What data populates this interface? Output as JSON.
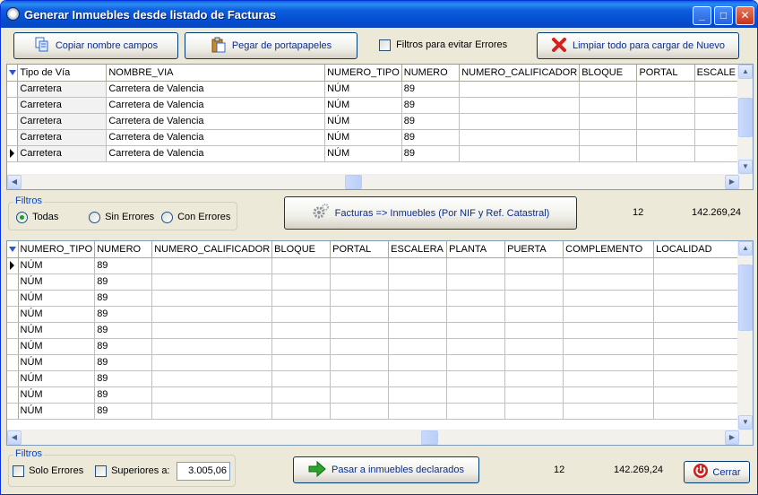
{
  "window": {
    "title": "Generar Inmuebles desde listado de Facturas",
    "controls": {
      "minimize": "_",
      "maximize": "□",
      "close": "✕"
    }
  },
  "toolbar": {
    "copy_fields": "Copiar nombre campos",
    "paste_clipboard": "Pegar de portapapeles",
    "filters_checkbox": "Filtros para evitar Errores",
    "clear_all": "Limpiar todo para cargar de Nuevo"
  },
  "top_grid": {
    "columns": [
      "Tipo de Vía",
      "NOMBRE_VIA",
      "NUMERO_TIPO",
      "NUMERO",
      "NUMERO_CALIFICADOR",
      "BLOQUE",
      "PORTAL",
      "ESCALE"
    ],
    "rows": [
      [
        "Carretera",
        "Carretera de Valencia",
        "NÚM",
        "89",
        "",
        "",
        "",
        ""
      ],
      [
        "Carretera",
        "Carretera de Valencia",
        "NÚM",
        "89",
        "",
        "",
        "",
        ""
      ],
      [
        "Carretera",
        "Carretera de Valencia",
        "NÚM",
        "89",
        "",
        "",
        "",
        ""
      ],
      [
        "Carretera",
        "Carretera de Valencia",
        "NÚM",
        "89",
        "",
        "",
        "",
        ""
      ],
      [
        "Carretera",
        "Carretera de Valencia",
        "NÚM",
        "89",
        "",
        "",
        "",
        ""
      ]
    ],
    "current_row": 4
  },
  "filters_top": {
    "label": "Filtros",
    "options": [
      "Todas",
      "Sin Errores",
      "Con Errores"
    ],
    "selected": "Todas"
  },
  "convert_button": "Facturas => Inmuebles (Por NIF y Ref. Catastral)",
  "top_summary": {
    "count": "12",
    "total": "142.269,24"
  },
  "bottom_grid": {
    "columns": [
      "NUMERO_TIPO",
      "NUMERO",
      "NUMERO_CALIFICADOR",
      "BLOQUE",
      "PORTAL",
      "ESCALERA",
      "PLANTA",
      "PUERTA",
      "COMPLEMENTO",
      "LOCALIDAD"
    ],
    "rows": [
      [
        "NÚM",
        "89",
        "",
        "",
        "",
        "",
        "",
        "",
        "",
        ""
      ],
      [
        "NÚM",
        "89",
        "",
        "",
        "",
        "",
        "",
        "",
        "",
        ""
      ],
      [
        "NÚM",
        "89",
        "",
        "",
        "",
        "",
        "",
        "",
        "",
        ""
      ],
      [
        "NÚM",
        "89",
        "",
        "",
        "",
        "",
        "",
        "",
        "",
        ""
      ],
      [
        "NÚM",
        "89",
        "",
        "",
        "",
        "",
        "",
        "",
        "",
        ""
      ],
      [
        "NÚM",
        "89",
        "",
        "",
        "",
        "",
        "",
        "",
        "",
        ""
      ],
      [
        "NÚM",
        "89",
        "",
        "",
        "",
        "",
        "",
        "",
        "",
        ""
      ],
      [
        "NÚM",
        "89",
        "",
        "",
        "",
        "",
        "",
        "",
        "",
        ""
      ],
      [
        "NÚM",
        "89",
        "",
        "",
        "",
        "",
        "",
        "",
        "",
        ""
      ],
      [
        "NÚM",
        "89",
        "",
        "",
        "",
        "",
        "",
        "",
        "",
        ""
      ]
    ],
    "current_row": 0
  },
  "filters_bottom": {
    "label": "Filtros",
    "only_errors": "Solo Errores",
    "greater_than": "Superiores a:",
    "threshold_value": "3.005,06"
  },
  "declare_button": "Pasar a inmuebles declarados",
  "bottom_summary": {
    "count": "12",
    "total": "142.269,24"
  },
  "close_button": "Cerrar"
}
